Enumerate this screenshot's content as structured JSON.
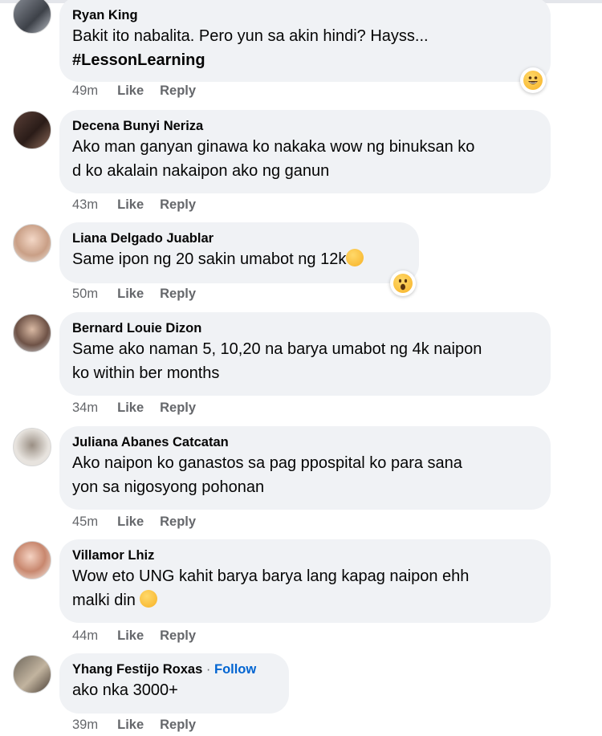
{
  "comments": [
    {
      "author": "Ryan King",
      "lines": [
        "Bakit ito nabalita. Pero yun sa akin hindi? Hayss..."
      ],
      "hashtag": "#LessonLearning",
      "time": "49m",
      "reaction": "grinning-face-icon"
    },
    {
      "author": "Decena Bunyi Neriza",
      "lines": [
        "Ako man ganyan ginawa ko nakaka wow ng binuksan ko",
        "d ko akalain nakaipon ako ng ganun"
      ],
      "time": "43m"
    },
    {
      "author": "Liana Delgado Juablar",
      "lines": [
        "Same ipon ng 20 sakin umabot ng 12k"
      ],
      "time": "50m",
      "reaction": "wow-face-icon"
    },
    {
      "author": "Bernard Louie Dizon",
      "lines": [
        "Same ako naman 5, 10,20 na barya umabot ng 4k naipon",
        "ko within ber months"
      ],
      "time": "34m"
    },
    {
      "author": "Juliana Abanes Catcatan",
      "lines": [
        "Ako naipon ko ganastos sa pag ppospital ko para sana",
        "yon sa nigosyong pohonan"
      ],
      "time": "45m"
    },
    {
      "author": "Villamor Lhiz",
      "lines": [
        "Wow eto UNG kahit barya barya lang kapag naipon ehh",
        "malki din"
      ],
      "time": "44m"
    },
    {
      "author": "Yhang Festijo Roxas",
      "follow": "Follow",
      "separator": "·",
      "lines": [
        "ako nka 3000+"
      ],
      "time": "39m"
    }
  ],
  "actions": {
    "like": "Like",
    "reply": "Reply"
  },
  "colors": {
    "bubble": "#f0f2f5",
    "meta": "#65676b",
    "follow": "#0064d1"
  }
}
